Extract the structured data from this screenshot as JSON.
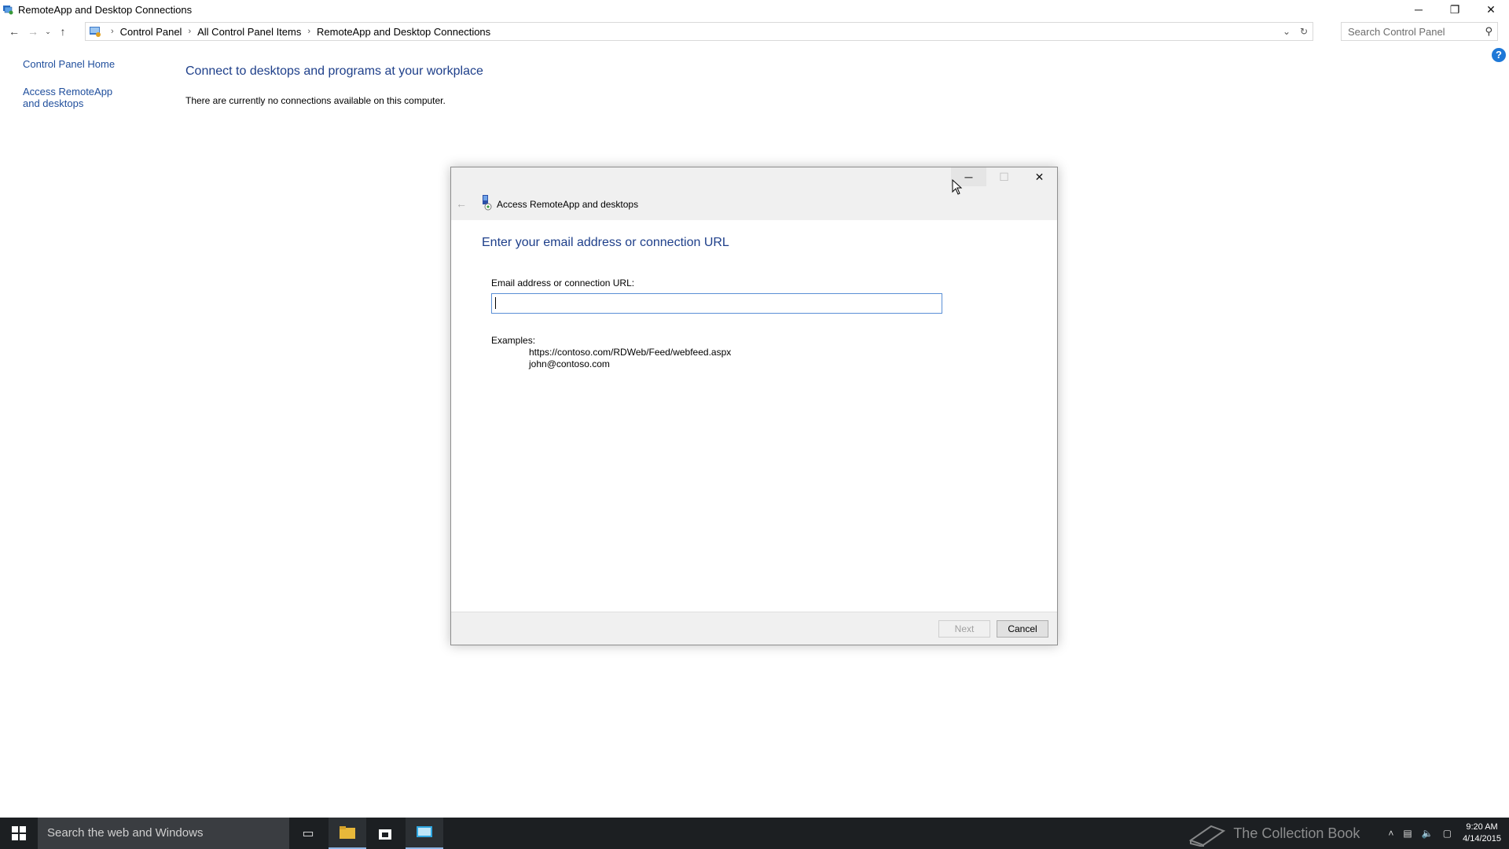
{
  "window": {
    "title": "RemoteApp and Desktop Connections",
    "controls": {
      "minimize": "─",
      "restore": "❐",
      "close": "✕"
    }
  },
  "address_bar": {
    "crumbs": [
      "Control Panel",
      "All Control Panel Items",
      "RemoteApp and Desktop Connections"
    ],
    "search_placeholder": "Search Control Panel"
  },
  "left_nav": {
    "items": [
      "Control Panel Home",
      "Access RemoteApp and desktops"
    ]
  },
  "main": {
    "heading": "Connect to desktops and programs at your workplace",
    "message": "There are currently no connections available on this computer."
  },
  "dialog": {
    "title": "Access RemoteApp and desktops",
    "heading": "Enter your email address or connection URL",
    "field_label": "Email address or connection URL:",
    "field_value": "",
    "examples_label": "Examples:",
    "examples": [
      "https://contoso.com/RDWeb/Feed/webfeed.aspx",
      "john@contoso.com"
    ],
    "next_label": "Next",
    "cancel_label": "Cancel"
  },
  "taskbar": {
    "search_placeholder": "Search the web and Windows",
    "watermark": "The Collection Book",
    "time": "9:20 AM",
    "date": "4/14/2015"
  },
  "colors": {
    "link": "#1f4e9c",
    "heading": "#1e3f8a",
    "taskbar": "#1c1f22"
  }
}
